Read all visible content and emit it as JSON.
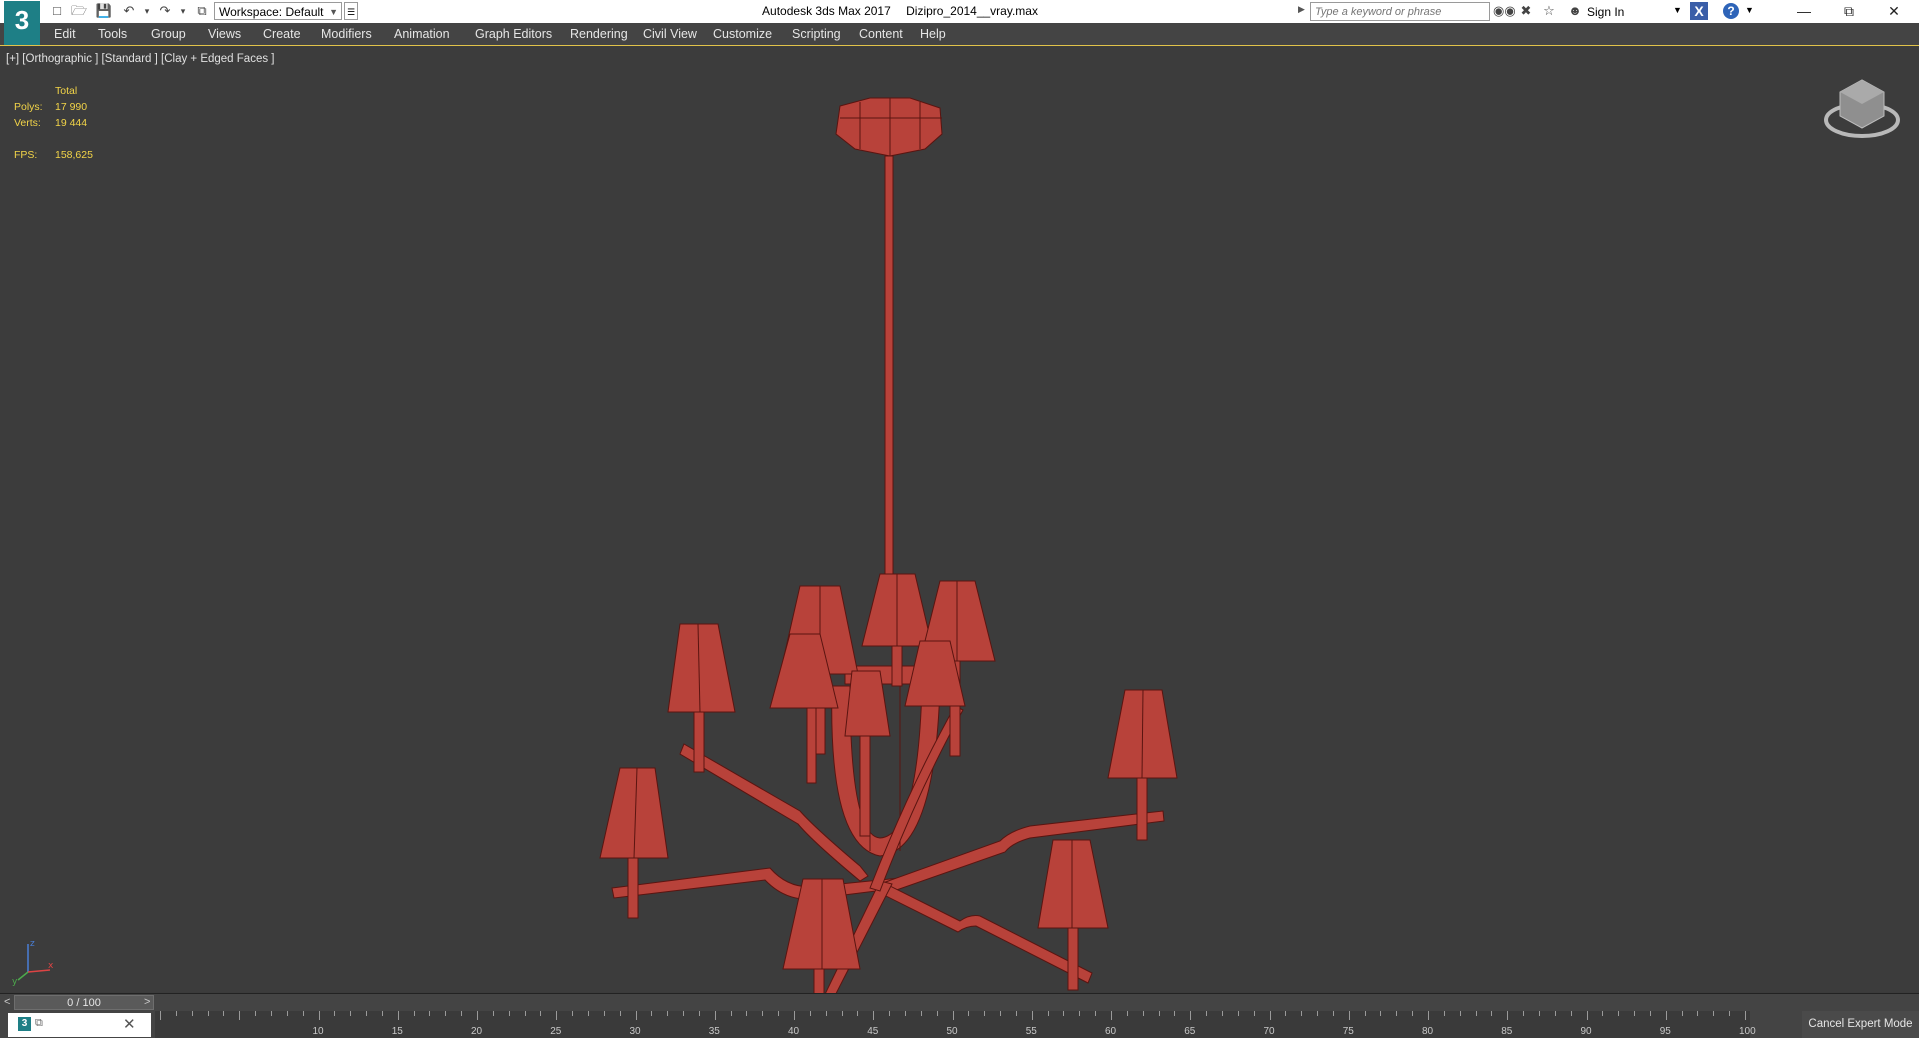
{
  "titlebar": {
    "app_name": "Autodesk 3ds Max 2017",
    "file_name": "Dizipro_2014__vray.max",
    "workspace": "Workspace: Default",
    "search_placeholder": "Type a keyword or phrase",
    "sign_in": "Sign In",
    "logo_text": "3"
  },
  "menu": [
    "Edit",
    "Tools",
    "Group",
    "Views",
    "Create",
    "Modifiers",
    "Animation",
    "Graph Editors",
    "Rendering",
    "Civil View",
    "Customize",
    "Scripting",
    "Content",
    "Help"
  ],
  "viewport": {
    "label": "[+] [Orthographic ] [Standard ] [Clay + Edged Faces ]",
    "stats": {
      "header": "Total",
      "polys_label": "Polys:",
      "polys_value": "17 990",
      "verts_label": "Verts:",
      "verts_value": "19 444",
      "fps_label": "FPS:",
      "fps_value": "158,625"
    },
    "model_color": "#b8423a",
    "axes": {
      "x": "x",
      "y": "y",
      "z": "z"
    }
  },
  "timeline": {
    "frame_display": "0 / 100",
    "prev": "<",
    "next": ">",
    "ticks": [
      "10",
      "15",
      "20",
      "25",
      "30",
      "35",
      "40",
      "45",
      "50",
      "55",
      "60",
      "65",
      "70",
      "75",
      "80",
      "85",
      "90",
      "95",
      "100"
    ]
  },
  "status": {
    "cancel_expert_mode": "Cancel Expert Mode"
  }
}
